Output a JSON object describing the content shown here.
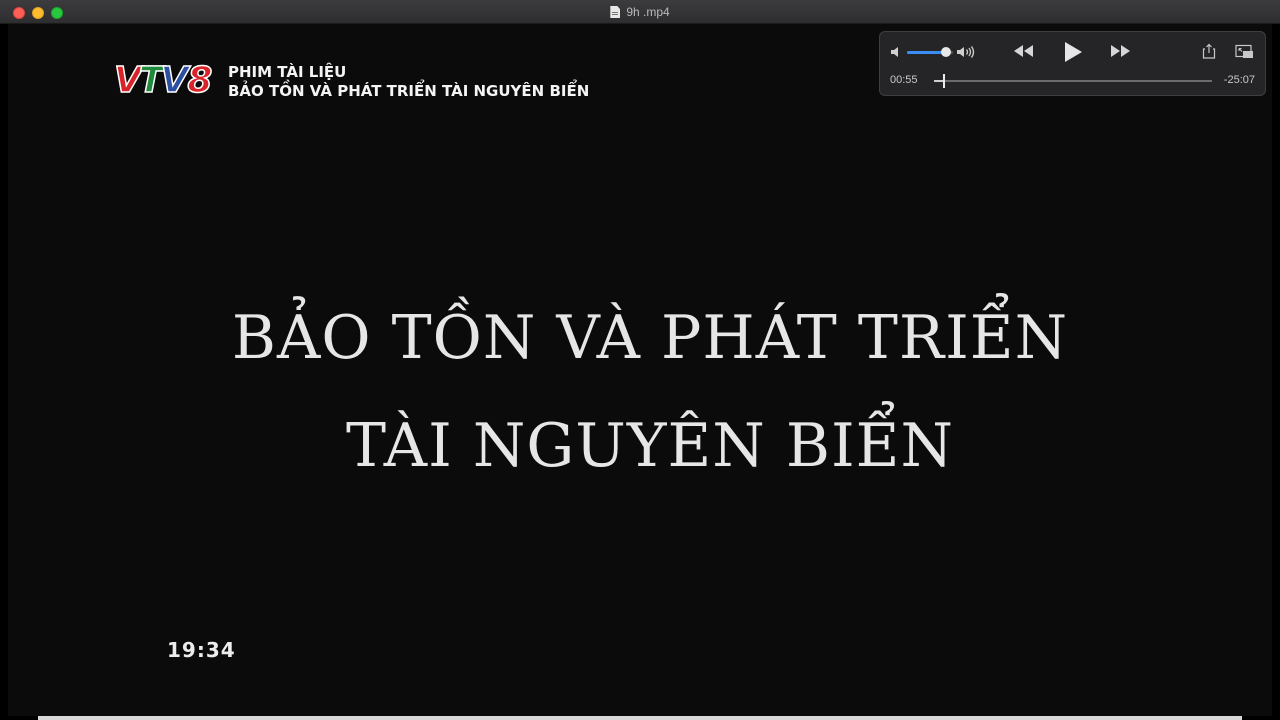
{
  "window": {
    "title": "9h .mp4"
  },
  "video": {
    "channel_logo": {
      "letters": [
        "V",
        "T",
        "V",
        "8"
      ],
      "text": "VTV8",
      "colors": [
        "#d8232a",
        "#1f8a3c",
        "#2c4fa3",
        "#d8232a"
      ]
    },
    "caption_line1": "PHIM TÀI LIỆU",
    "caption_line2": "BẢO TỒN VÀ PHÁT TRIỂN TÀI NGUYÊN BIỂN",
    "title_line1": "BẢO TỒN VÀ PHÁT TRIỂN",
    "title_line2": "TÀI NGUYÊN BIỂN",
    "clock": "19:34"
  },
  "controls": {
    "volume_level": 0.85,
    "elapsed": "00:55",
    "remaining": "-25:07",
    "progress": 0.035,
    "accent_color": "#3a8df5",
    "icons": {
      "volume_low": "speaker-low-icon",
      "volume_high": "speaker-high-icon",
      "rewind": "rewind-icon",
      "play": "play-icon",
      "fast_forward": "fast-forward-icon",
      "share": "share-icon",
      "pip": "picture-in-picture-icon"
    }
  }
}
